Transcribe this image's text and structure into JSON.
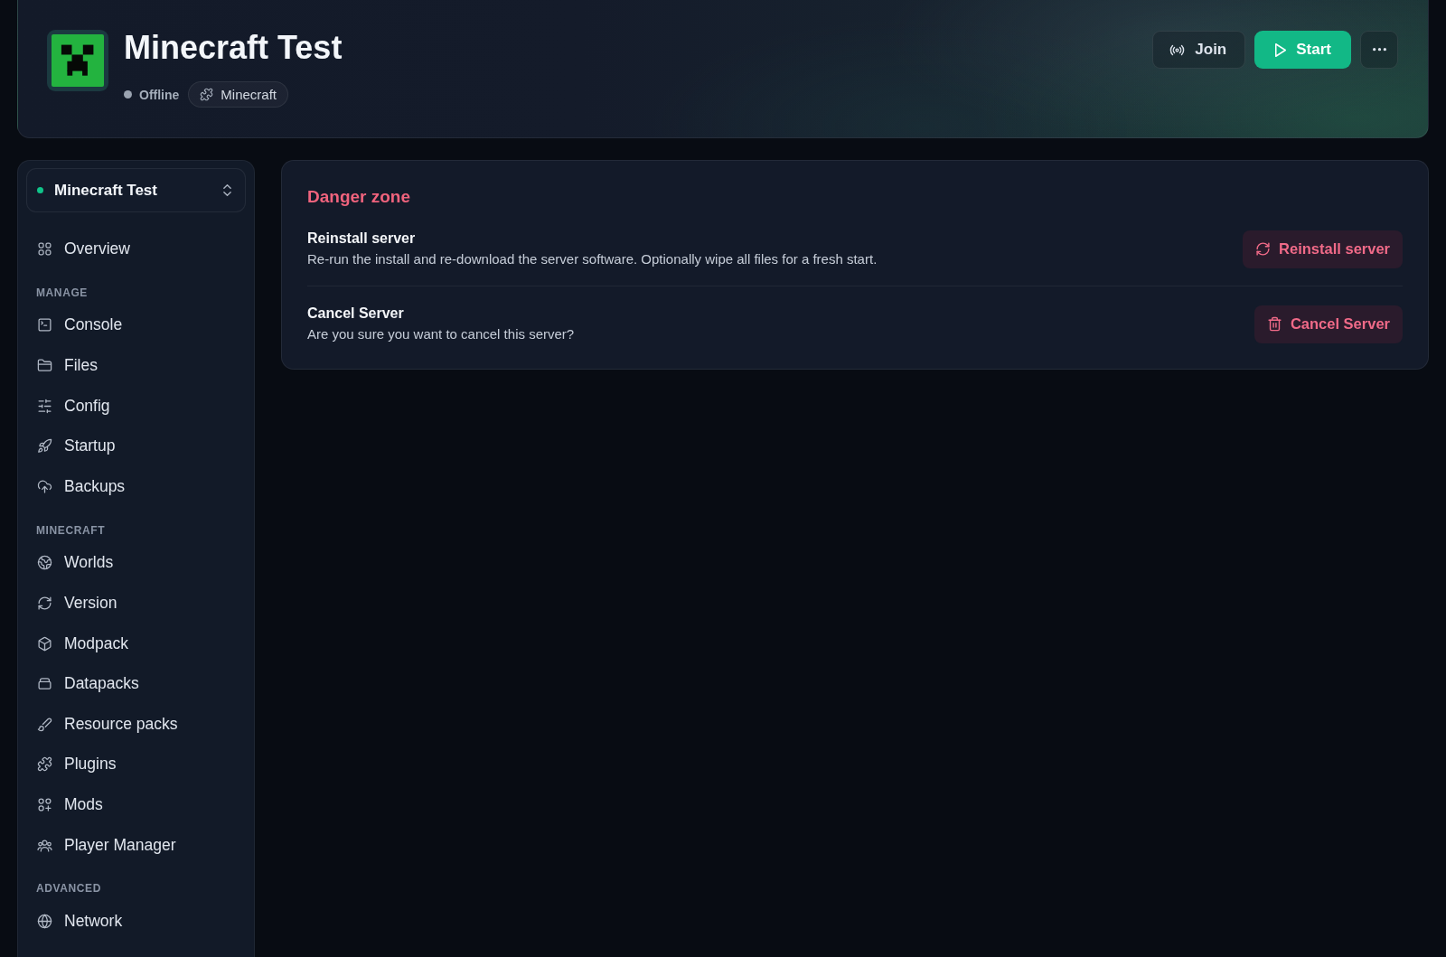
{
  "header": {
    "title": "Minecraft Test",
    "status": "Offline",
    "game": "Minecraft",
    "actions": [
      {
        "kind": "join",
        "label": "Join"
      },
      {
        "kind": "start",
        "label": "Start"
      },
      {
        "kind": "more"
      }
    ]
  },
  "sidebar": {
    "server": "Minecraft Test",
    "sections": [
      {
        "items": [
          {
            "label": "Overview",
            "selected": false
          }
        ]
      },
      {
        "label": "MANAGE",
        "items": [
          {
            "label": "Console",
            "selected": false
          },
          {
            "label": "Files",
            "selected": false
          },
          {
            "label": "Config",
            "selected": false
          },
          {
            "label": "Startup",
            "selected": false
          },
          {
            "label": "Backups",
            "selected": false
          }
        ]
      },
      {
        "label": "MINECRAFT",
        "items": [
          {
            "label": "Worlds",
            "selected": false
          },
          {
            "label": "Version",
            "selected": false
          },
          {
            "label": "Modpack",
            "selected": false
          },
          {
            "label": "Datapacks",
            "selected": false
          },
          {
            "label": "Resource packs",
            "selected": false
          },
          {
            "label": "Plugins",
            "selected": false
          },
          {
            "label": "Mods",
            "selected": false
          },
          {
            "label": "Player Manager",
            "selected": false
          }
        ]
      },
      {
        "label": "ADVANCED",
        "items": [
          {
            "label": "Network",
            "selected": false
          }
        ]
      }
    ]
  },
  "danger_zone": {
    "title": "Danger zone",
    "rows": [
      {
        "title": "Reinstall server",
        "description": "Re-run the install and re-download the server software. Optionally wipe all files for a fresh start.",
        "action": "Reinstall server"
      },
      {
        "title": "Cancel Server",
        "description": "Are you sure you want to cancel this server?",
        "action": "Cancel Server"
      }
    ]
  }
}
